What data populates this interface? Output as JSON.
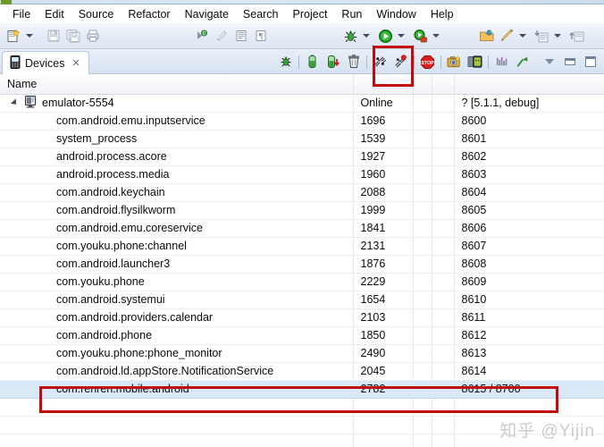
{
  "window": {
    "title_icon": "eclipse-icon"
  },
  "menubar": {
    "items": [
      {
        "label": "File",
        "name": "menu-file"
      },
      {
        "label": "Edit",
        "name": "menu-edit"
      },
      {
        "label": "Source",
        "name": "menu-source"
      },
      {
        "label": "Refactor",
        "name": "menu-refactor"
      },
      {
        "label": "Navigate",
        "name": "menu-navigate"
      },
      {
        "label": "Search",
        "name": "menu-search"
      },
      {
        "label": "Project",
        "name": "menu-project"
      },
      {
        "label": "Run",
        "name": "menu-run"
      },
      {
        "label": "Window",
        "name": "menu-window"
      },
      {
        "label": "Help",
        "name": "menu-help"
      }
    ]
  },
  "toolbar": {
    "buttons": [
      {
        "name": "new-wizard-icon",
        "tooltip": "New"
      },
      {
        "name": "new-dropdown-caret",
        "tooltip": "New menu"
      },
      {
        "name": "save-icon",
        "tooltip": "Save"
      },
      {
        "name": "save-all-icon",
        "tooltip": "Save All"
      },
      {
        "name": "print-icon",
        "tooltip": "Print"
      },
      {
        "name": "toggle-mark-occurrences-icon",
        "tooltip": "Toggle Mark Occurrences"
      },
      {
        "name": "skip-all-breakpoints-icon",
        "tooltip": "Skip All Breakpoints"
      },
      {
        "name": "show-whitespace-icon",
        "tooltip": "Show Whitespace Characters"
      },
      {
        "name": "block-selection-icon",
        "tooltip": "Toggle Block Selection"
      },
      {
        "name": "debug-icon",
        "tooltip": "Debug"
      },
      {
        "name": "debug-dropdown-caret",
        "tooltip": "Debug menu"
      },
      {
        "name": "run-icon",
        "tooltip": "Run"
      },
      {
        "name": "run-dropdown-caret",
        "tooltip": "Run menu"
      },
      {
        "name": "external-tools-icon",
        "tooltip": "External Tools"
      },
      {
        "name": "external-tools-caret",
        "tooltip": "External Tools menu"
      },
      {
        "name": "open-type-icon",
        "tooltip": "Open Type"
      },
      {
        "name": "new-android-project-icon",
        "tooltip": "New Android Project"
      },
      {
        "name": "new-android-caret",
        "tooltip": "New Android menu"
      },
      {
        "name": "previous-annotation-icon",
        "tooltip": "Previous Annotation"
      },
      {
        "name": "previous-annotation-caret",
        "tooltip": "Previous Annotation menu"
      },
      {
        "name": "next-edit-location-icon",
        "tooltip": "Next Edit Location"
      }
    ]
  },
  "view": {
    "tab": {
      "label": "Devices",
      "icon": "device-phone-icon",
      "close": "✕"
    },
    "tools": [
      {
        "name": "debug-process-icon",
        "tooltip": "Debug the selected process"
      },
      {
        "name": "update-heap-icon",
        "tooltip": "Update Heap"
      },
      {
        "name": "dump-hprof-file-icon",
        "tooltip": "Dump HPROF file"
      },
      {
        "name": "cause-gc-icon",
        "tooltip": "Cause GC"
      },
      {
        "name": "update-threads-icon",
        "tooltip": "Update Threads"
      },
      {
        "name": "start-method-profiling-icon",
        "tooltip": "Start Method Profiling"
      },
      {
        "name": "stop-process-icon",
        "tooltip": "Stop Process"
      },
      {
        "name": "screen-capture-icon",
        "tooltip": "Screen Capture"
      },
      {
        "name": "dump-view-hierarchy-icon",
        "tooltip": "Dump View Hierarchy for UI Automator"
      },
      {
        "name": "systrace-icon",
        "tooltip": "Capture system wide trace using Android systrace"
      },
      {
        "name": "reset-adb-icon",
        "tooltip": "Reset adb"
      },
      {
        "name": "view-menu-icon",
        "tooltip": "View Menu"
      },
      {
        "name": "minimize-icon",
        "tooltip": "Minimize"
      },
      {
        "name": "maximize-icon",
        "tooltip": "Maximize"
      }
    ]
  },
  "table": {
    "headers": [
      "Name",
      "",
      "",
      "",
      ""
    ],
    "device": {
      "name": "emulator-5554",
      "status": "Online",
      "blank1": "",
      "blank2": "",
      "info": "? [5.1.1, debug]"
    },
    "rows": [
      {
        "name": "com.android.emu.inputservice",
        "pid": "1696",
        "b1": "",
        "b2": "",
        "port": "8600",
        "selected": false
      },
      {
        "name": "system_process",
        "pid": "1539",
        "b1": "",
        "b2": "",
        "port": "8601",
        "selected": false
      },
      {
        "name": "android.process.acore",
        "pid": "1927",
        "b1": "",
        "b2": "",
        "port": "8602",
        "selected": false
      },
      {
        "name": "android.process.media",
        "pid": "1960",
        "b1": "",
        "b2": "",
        "port": "8603",
        "selected": false
      },
      {
        "name": "com.android.keychain",
        "pid": "2088",
        "b1": "",
        "b2": "",
        "port": "8604",
        "selected": false
      },
      {
        "name": "com.android.flysilkworm",
        "pid": "1999",
        "b1": "",
        "b2": "",
        "port": "8605",
        "selected": false
      },
      {
        "name": "com.android.emu.coreservice",
        "pid": "1841",
        "b1": "",
        "b2": "",
        "port": "8606",
        "selected": false
      },
      {
        "name": "com.youku.phone:channel",
        "pid": "2131",
        "b1": "",
        "b2": "",
        "port": "8607",
        "selected": false
      },
      {
        "name": "com.android.launcher3",
        "pid": "1876",
        "b1": "",
        "b2": "",
        "port": "8608",
        "selected": false
      },
      {
        "name": "com.youku.phone",
        "pid": "2229",
        "b1": "",
        "b2": "",
        "port": "8609",
        "selected": false
      },
      {
        "name": "com.android.systemui",
        "pid": "1654",
        "b1": "",
        "b2": "",
        "port": "8610",
        "selected": false
      },
      {
        "name": "com.android.providers.calendar",
        "pid": "2103",
        "b1": "",
        "b2": "",
        "port": "8611",
        "selected": false
      },
      {
        "name": "com.android.phone",
        "pid": "1850",
        "b1": "",
        "b2": "",
        "port": "8612",
        "selected": false
      },
      {
        "name": "com.youku.phone:phone_monitor",
        "pid": "2490",
        "b1": "",
        "b2": "",
        "port": "8613",
        "selected": false
      },
      {
        "name": "com.android.ld.appStore.NotificationService",
        "pid": "2045",
        "b1": "",
        "b2": "",
        "port": "8614",
        "selected": false
      },
      {
        "name": "com.renren.mobile.android",
        "pid": "2782",
        "b1": "",
        "b2": "",
        "port": "8615 / 8700",
        "selected": true
      }
    ]
  },
  "annotations": [
    {
      "name": "annotation-box-debug-button",
      "color": "#c00c0c"
    },
    {
      "name": "annotation-box-selected-row",
      "color": "#c00c0c"
    }
  ],
  "watermark": {
    "text": "知乎 @Yijin"
  }
}
